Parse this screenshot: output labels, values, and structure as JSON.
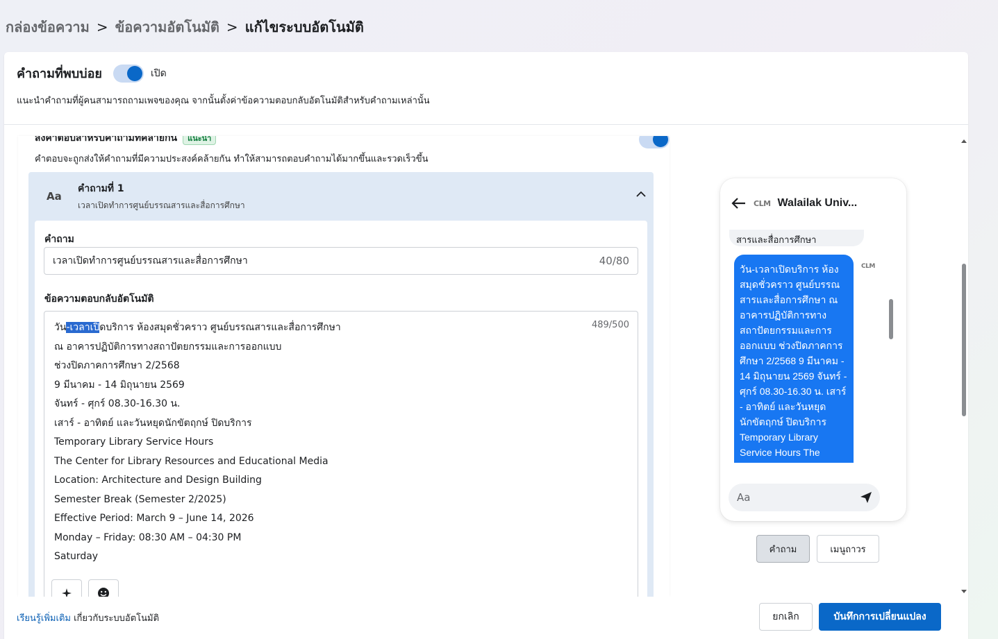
{
  "breadcrumb": {
    "items": [
      "กล่องข้อความ",
      "ข้อความอัตโนมัติ"
    ],
    "current": "แก้ไขระบบอัตโนมัติ",
    "separator": ">"
  },
  "faq": {
    "title": "คำถามที่พบบ่อย",
    "toggle_label": "เปิด",
    "toggle_on": true,
    "description": "แนะนำคำถามที่ผู้คนสามารถถามเพจของคุณ จากนั้นตั้งค่าข้อความตอบกลับอัตโนมัติสำหรับคำถามเหล่านั้น"
  },
  "similar": {
    "title": "ส่งคำตอบสำหรับคำถามที่คล้ายกัน",
    "badge": "แนะนำ",
    "description": "คำตอบจะถูกส่งให้คำถามที่มีความประสงค์คล้ายกัน ทำให้สามารถตอบคำถามได้มากขึ้นและรวดเร็วขึ้น",
    "toggle_on": true
  },
  "question": {
    "icon_text": "Aa",
    "title": "คำถามที่ 1",
    "subtitle": "เวลาเปิดทำการศูนย์บรรณสารและสื่อการศึกษา",
    "question_label": "คำถาม",
    "question_value": "เวลาเปิดทำการศูนย์บรรณสารและสื่อการศึกษา",
    "question_counter": "40/80",
    "reply_label": "ข้อความตอบกลับอัตโนมัติ",
    "reply_counter": "489/500",
    "reply_first_prefix": "วัน",
    "reply_first_highlight": "-เวลาเปิ",
    "reply_first_suffix": "ดบริการ ห้องสมุดชั่วคราว ศูนย์บรรณสารและสื่อการศึกษา",
    "reply_lines": [
      "ณ อาคารปฏิบัติการทางสถาปัตยกรรมและการออกแบบ",
      "ช่วงปิดภาคการศึกษา 2/2568",
      "9 มีนาคม - 14 มิถุนายน 2569",
      "จันทร์ - ศุกร์ 08.30-16.30 น.",
      "เสาร์ - อาทิตย์ และวันหยุดนักขัตฤกษ์ ปิดบริการ",
      "Temporary Library Service Hours",
      "The Center for Library Resources and Educational Media",
      "Location: Architecture and Design Building",
      "Semester Break (Semester 2/2025)",
      "Effective Period: March 9 – June 14, 2026",
      "Monday – Friday: 08:30 AM – 04:30 PM",
      "Saturday"
    ]
  },
  "preview": {
    "logo_text": "CLM",
    "page_name": "Walailak Univ...",
    "incoming_text": "สารและสื่อการศึกษา",
    "outgoing_text": "วัน-เวลาเปิดบริการ ห้องสมุดชั่วคราว ศูนย์บรรณสารและสื่อการศึกษา ณ อาคารปฏิบัติการทางสถาปัตยกรรมและการออกแบบ ช่วงปิดภาคการศึกษา 2/2568 9 มีนาคม - 14 มิถุนายน 2569 จันทร์ - ศุกร์ 08.30-16.30 น. เสาร์ - อาทิตย์ และวันหยุดนักขัตฤกษ์ ปิดบริการ Temporary Library Service Hours The",
    "input_placeholder": "Aa",
    "tabs": [
      {
        "label": "คำถาม",
        "active": true
      },
      {
        "label": "เมนูถาวร",
        "active": false
      }
    ]
  },
  "footer": {
    "link_text": "เรียนรู้เพิ่มเติม",
    "text": " เกี่ยวกับระบบอัตโนมัติ",
    "cancel_label": "ยกเลิก",
    "save_label": "บันทึกการเปลี่ยนแปลง"
  },
  "colors": {
    "accent": "#0a68c8",
    "bubble": "#1877f2",
    "panel": "#dfe9f5"
  }
}
